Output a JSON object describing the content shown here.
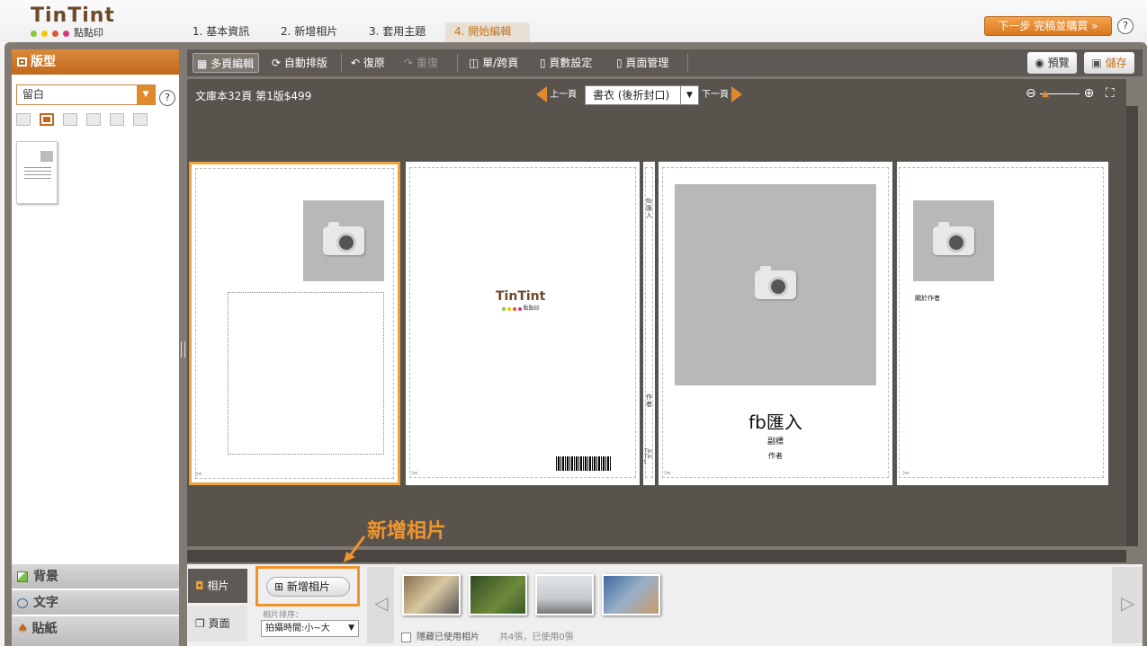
{
  "app": {
    "logo_word": "TinTint",
    "logo_sub": "點點印",
    "dot_colors": [
      "#8cc63f",
      "#f7c600",
      "#e2572c",
      "#d63a7a"
    ]
  },
  "steps": [
    "1. 基本資訊",
    "2. 新增相片",
    "3. 套用主題",
    "4. 開始編輯"
  ],
  "header": {
    "next_label": "下一步 完稿並購買 »",
    "help": "?"
  },
  "left_panel": {
    "title": "版型",
    "layout_value": "留白",
    "help": "?",
    "tabs": [
      "背景",
      "文字",
      "貼紙"
    ]
  },
  "toolbar": {
    "multi_edit": "多頁編輯",
    "auto_layout": "自動排版",
    "undo": "復原",
    "redo": "重復",
    "single_spread": "單/跨頁",
    "page_count": "頁數設定",
    "page_manage": "頁面管理",
    "preview": "預覽",
    "save": "儲存"
  },
  "canvas": {
    "info": "文庫本32頁 第1版$499",
    "prev_label": "上一頁",
    "next_label": "下一頁",
    "page_value": "書衣 (後折封口)"
  },
  "pages": {
    "spine_label": "fb匯入",
    "spine_bottom": "作者",
    "spine_brand": "TinTint",
    "cover_title": "fb匯入",
    "cover_subtitle": "副標",
    "cover_author": "作者",
    "flap_text": "關於作者",
    "logo_word": "TinTint",
    "logo_sub": "點點印"
  },
  "bottom": {
    "tab_photos": "相片",
    "tab_pages": "頁面",
    "add_photo": "新增相片",
    "sort_label": "相片排序：",
    "sort_value": "拍攝時間:小~大",
    "hide_used": "隱藏已使用相片",
    "count_text": "共4張，已使用0張"
  },
  "callout": {
    "text": "新增相片"
  },
  "photos": [
    {
      "colors": [
        "#6a6a5a",
        "#d8c89a"
      ]
    },
    {
      "colors": [
        "#2f4a22",
        "#6e8a3c"
      ]
    },
    {
      "colors": [
        "#cfd6dc",
        "#7a7c7a"
      ]
    },
    {
      "colors": [
        "#3f6aa0",
        "#c89a6a"
      ]
    }
  ],
  "accent": "#e08a2c"
}
